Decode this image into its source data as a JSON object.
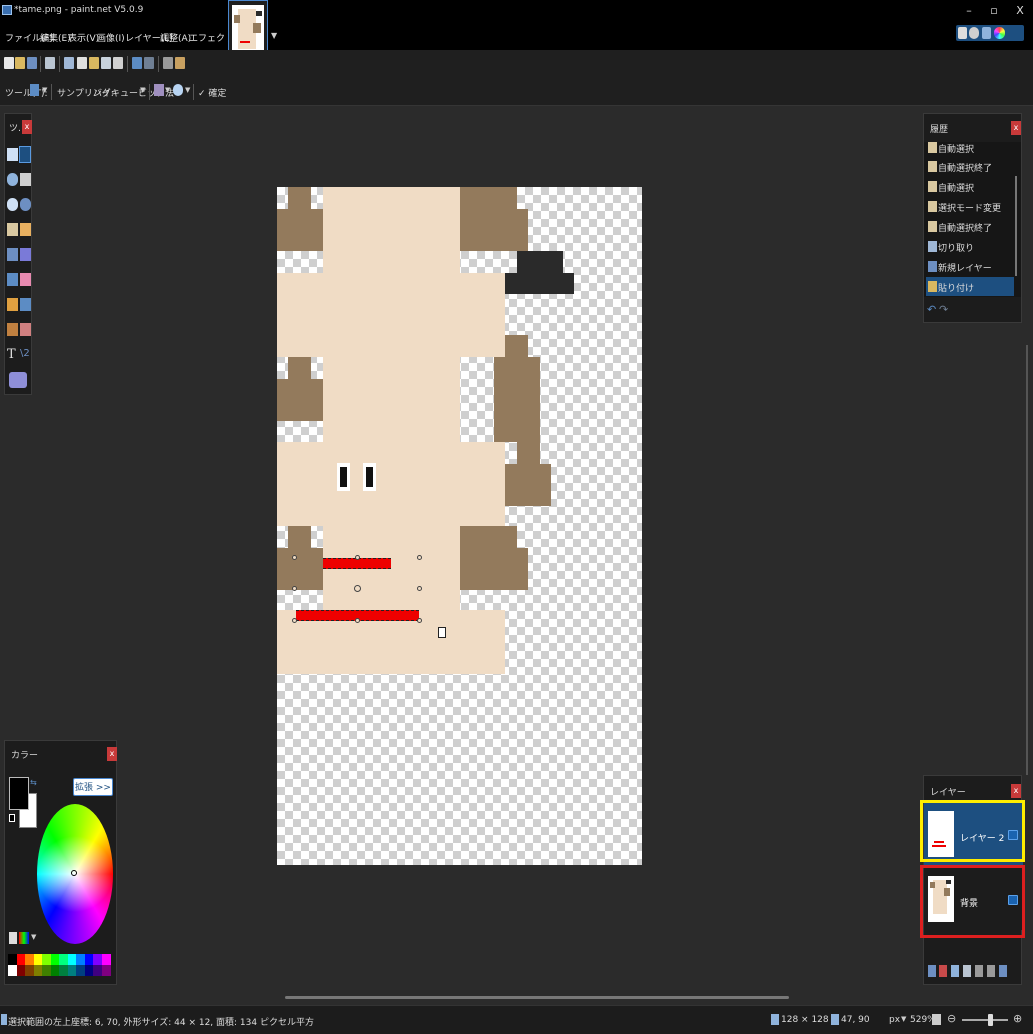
{
  "window": {
    "title": "*tame.png - paint.net V5.0.9",
    "minimize_glyph": "–",
    "restore_glyph": "▫",
    "close_glyph": "X"
  },
  "menu": [
    "ファイル(F)",
    "編集(E)",
    "表示(V)",
    "画像(I)",
    "レイヤー(L)",
    "調整(A)",
    "エフェクト(C)"
  ],
  "toolbar2": {
    "tool_label": "ツール(T):",
    "sampling_label": "サンプリング:",
    "sampling_value": "バイキュービック法",
    "confirm_label": "✓ 確定"
  },
  "tools_panel": {
    "title": "ツ…",
    "close": "x"
  },
  "history_panel": {
    "title": "履歴",
    "close": "x",
    "items": [
      {
        "label": "自動選択",
        "icon": "magic-wand-icon"
      },
      {
        "label": "自動選択終了",
        "icon": "magic-wand-icon"
      },
      {
        "label": "自動選択",
        "icon": "magic-wand-icon"
      },
      {
        "label": "選択モード変更",
        "icon": "magic-wand-icon"
      },
      {
        "label": "自動選択終了",
        "icon": "magic-wand-icon"
      },
      {
        "label": "切り取り",
        "icon": "scissors-icon"
      },
      {
        "label": "新規レイヤー",
        "icon": "new-layer-icon"
      },
      {
        "label": "貼り付け",
        "icon": "paste-icon"
      }
    ],
    "selected_index": 7
  },
  "colors_panel": {
    "title": "カラー",
    "close": "x",
    "expand_label": "拡張 >>",
    "primary_color": "#000000",
    "secondary_color": "#ffffff",
    "palette": [
      "#000000",
      "#ff0000",
      "#ff7f00",
      "#ffff00",
      "#7fff00",
      "#00ff00",
      "#00ff7f",
      "#00ffff",
      "#007fff",
      "#0000ff",
      "#7f00ff",
      "#ff00ff"
    ],
    "palette_dark": [
      "#ffffff",
      "#7f0000",
      "#7f3f00",
      "#7f7f00",
      "#3f7f00",
      "#007f00",
      "#007f3f",
      "#007f7f",
      "#003f7f",
      "#00007f",
      "#3f007f",
      "#7f007f"
    ]
  },
  "layers_panel": {
    "title": "レイヤー",
    "close": "x",
    "layers": [
      {
        "name": "レイヤー 2",
        "visible": true,
        "selected": true
      },
      {
        "name": "背景",
        "visible": true,
        "selected": false
      }
    ]
  },
  "statusbar": {
    "selection_info": "選択範囲の左上座標: 6, 70, 外形サイズ: 44 × 12, 面積: 134 ピクセル平方",
    "image_size": "128 × 128",
    "cursor_pos": "47, 90",
    "unit": "px",
    "zoom": "529%"
  }
}
